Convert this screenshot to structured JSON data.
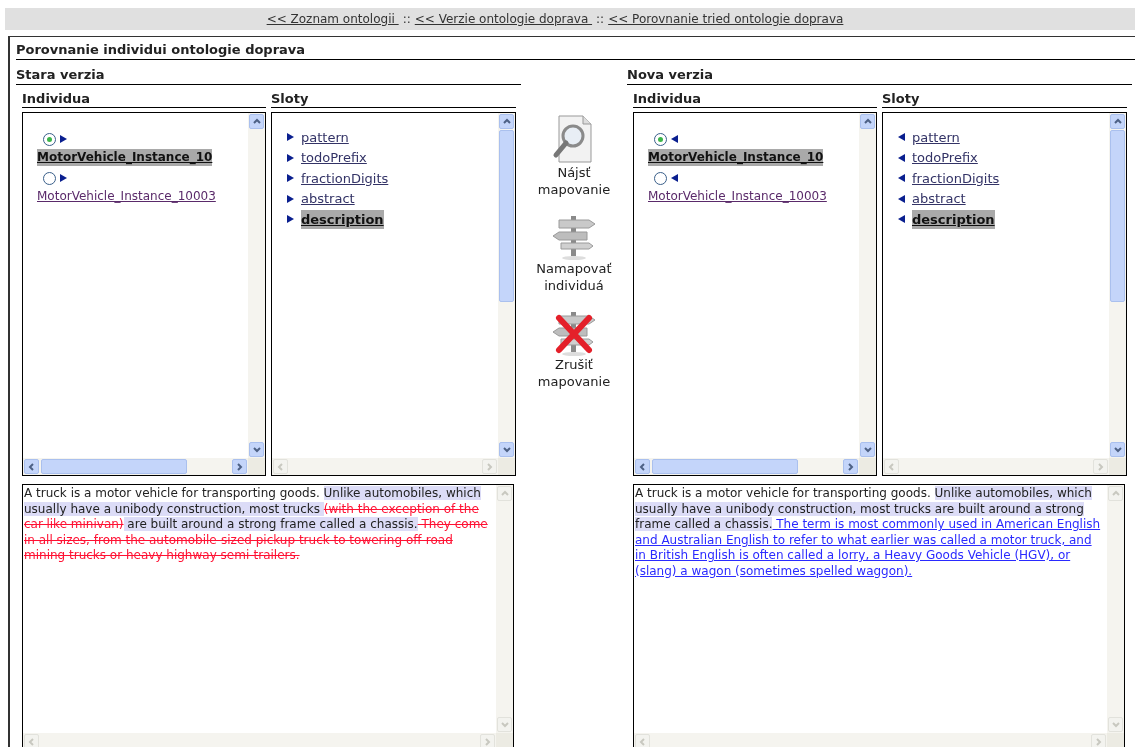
{
  "nav": {
    "separator": "::",
    "links": [
      "<< Zoznam ontologii ",
      "<< Verzie ontologie doprava ",
      "<< Porovnanie tried ontologie doprava"
    ]
  },
  "title": "Porovnanie individui ontologie doprava",
  "versions": [
    {
      "heading": "Stara verzia",
      "kind": "old",
      "individuals_heading": "Individua",
      "slots_heading": "Sloty",
      "individuals": [
        {
          "name": "MotorVehicle_Instance_10",
          "selected": true
        },
        {
          "name": "MotorVehicle_Instance_10003",
          "selected": false
        }
      ],
      "slots": [
        {
          "name": "pattern",
          "selected": false
        },
        {
          "name": "todoPrefix",
          "selected": false
        },
        {
          "name": "fractionDigits",
          "selected": false
        },
        {
          "name": "abstract",
          "selected": false
        },
        {
          "name": "description",
          "selected": true
        }
      ],
      "description": [
        {
          "kind": "plain",
          "text": "A truck is a motor vehicle for transporting goods. "
        },
        {
          "kind": "same",
          "text": "Unlike automobiles, which usually have a unibody construction, most trucks "
        },
        {
          "kind": "deleted",
          "text": "(with the exception of the car-like minivan)"
        },
        {
          "kind": "same",
          "text": " are built around a strong frame called a chassis."
        },
        {
          "kind": "deleted",
          "text": " They come in all sizes, from the automobile-sized pickup truck to towering off-road mining trucks or heavy highway semi-trailers."
        }
      ]
    },
    {
      "heading": "Nova verzia",
      "kind": "new",
      "individuals_heading": "Individua",
      "slots_heading": "Sloty",
      "individuals": [
        {
          "name": "MotorVehicle_Instance_10",
          "selected": true
        },
        {
          "name": "MotorVehicle_Instance_10003",
          "selected": false
        }
      ],
      "slots": [
        {
          "name": "pattern",
          "selected": false
        },
        {
          "name": "todoPrefix",
          "selected": false
        },
        {
          "name": "fractionDigits",
          "selected": false
        },
        {
          "name": "abstract",
          "selected": false
        },
        {
          "name": "description",
          "selected": true
        }
      ],
      "description": [
        {
          "kind": "plain",
          "text": "A truck is a motor vehicle for transporting goods. "
        },
        {
          "kind": "same",
          "text": "Unlike automobiles, which usually have a unibody construction, most trucks are built around a strong frame called a chassis."
        },
        {
          "kind": "inserted",
          "text": " The term is most commonly used in American English and Australian English to refer to what earlier was called a motor truck, and in British English is often called a lorry, a Heavy Goods Vehicle (HGV), or (slang) a wagon (sometimes spelled waggon)."
        }
      ]
    }
  ],
  "actions": [
    {
      "kind": "find",
      "label": "Nájsť mapovanie"
    },
    {
      "kind": "map",
      "label": "Namapovať individuá"
    },
    {
      "kind": "unmap",
      "label": "Zrušiť mapovanie"
    }
  ]
}
